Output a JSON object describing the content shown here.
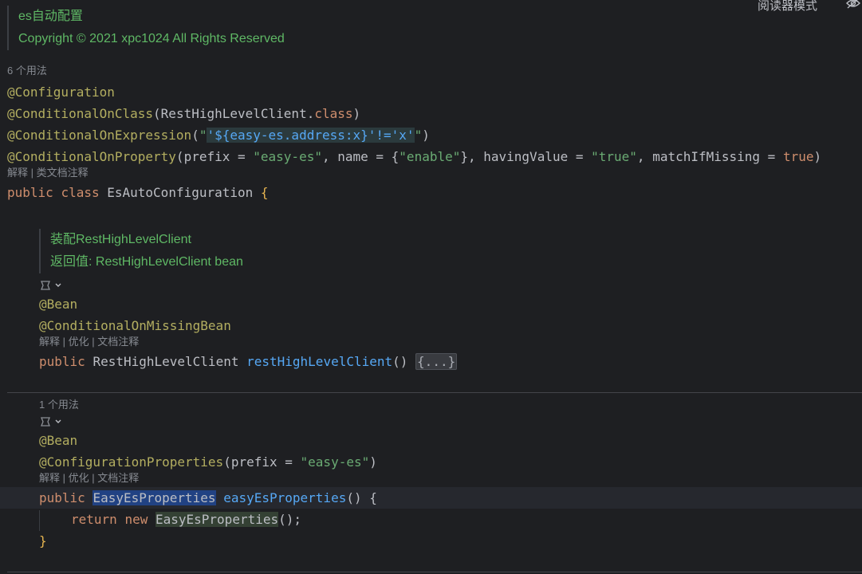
{
  "header": {
    "reader_mode_label": "阅读器模式",
    "reader_mode_icon": "eye-off-icon"
  },
  "class_doc": {
    "title": "es自动配置",
    "copyright": "Copyright © 2021 xpc1024 All Rights Reserved"
  },
  "class_usages": "6 个用法",
  "annotations": {
    "configuration": "@Configuration",
    "conditional_on_class": "@ConditionalOnClass",
    "conditional_on_class_arg": "RestHighLevelClient.",
    "class_kw": "class",
    "conditional_on_expression": "@ConditionalOnExpression",
    "expr_quote": "\"",
    "expr_literal": "'${easy-es.address:x}'!='x'",
    "conditional_on_property": "@ConditionalOnProperty",
    "prop_prefix_key": "prefix = ",
    "prop_prefix_val": "\"easy-es\"",
    "prop_name_key": ", name = {",
    "prop_name_val": "\"enable\"",
    "prop_having_key": "}, havingValue = ",
    "prop_having_val": "\"true\"",
    "prop_missing_key": ", matchIfMissing = ",
    "prop_missing_val": "true"
  },
  "class_actions": "解释 | 类文档注释",
  "class_decl": {
    "public": "public",
    "class": "class",
    "name": "EsAutoConfiguration",
    "brace": "{"
  },
  "method1": {
    "doc_line1": "装配RestHighLevelClient",
    "doc_line2": "返回值: RestHighLevelClient bean",
    "icon": "bean-gutter-icon",
    "bean": "@Bean",
    "missing_bean": "@ConditionalOnMissingBean",
    "actions": "解释 | 优化 | 文档注释",
    "public": "public",
    "return_type": "RestHighLevelClient",
    "name": "restHighLevelClient",
    "parens": "()",
    "folded": "{...}"
  },
  "method2": {
    "usages": "1 个用法",
    "icon": "bean-gutter-icon",
    "bean": "@Bean",
    "config_props": "@ConfigurationProperties",
    "prefix_key": "prefix = ",
    "prefix_val": "\"easy-es\"",
    "actions": "解释 | 优化 | 文档注释",
    "public": "public",
    "return_type": "EasyEsProperties",
    "name": "easyEsProperties",
    "parens": "() {",
    "return_kw": "return",
    "new_kw": "new",
    "new_type": "EasyEsProperties",
    "new_tail": "();",
    "close_brace": "}"
  }
}
